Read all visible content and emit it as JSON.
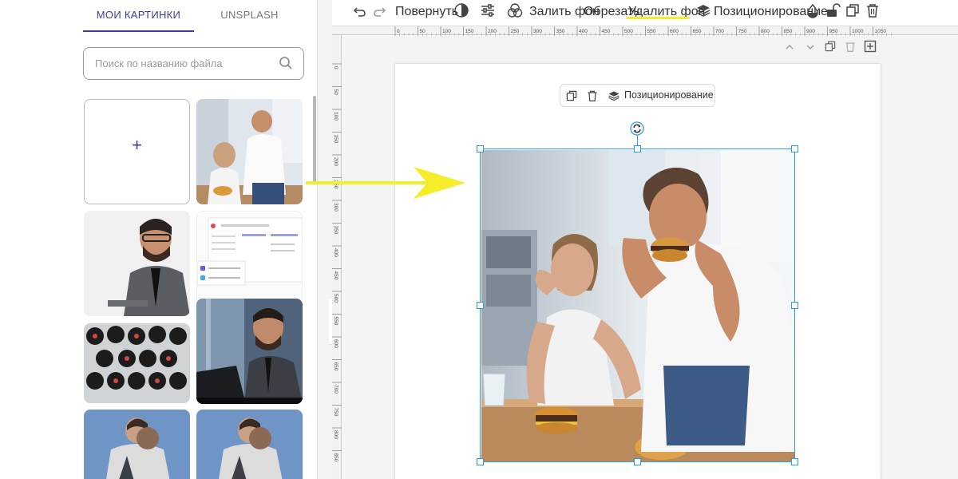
{
  "left_panel": {
    "tabs": [
      {
        "label": "МОИ КАРТИНКИ",
        "active": true
      },
      {
        "label": "UNSPLASH",
        "active": false
      }
    ],
    "search": {
      "placeholder": "Поиск по названию файла"
    },
    "add_tile": {
      "label": "+"
    }
  },
  "toolbar": {
    "rotate_label": "Повернуть",
    "fill_bg_label": "Залить фон",
    "crop_label": "Обрезать",
    "remove_bg_label": "Удалить фон",
    "positioning_label": "Позиционирование",
    "highlight_color": "#f5ec2a"
  },
  "ruler": {
    "h_ticks": [
      "0",
      "50",
      "100",
      "150",
      "200",
      "250",
      "300",
      "350",
      "400",
      "450",
      "500",
      "550",
      "600",
      "650",
      "700",
      "750",
      "800",
      "850",
      "900",
      "950",
      "1000",
      "1050"
    ],
    "v_ticks": [
      "0",
      "50",
      "100",
      "150",
      "200",
      "250",
      "300",
      "350",
      "400",
      "450",
      "500",
      "550",
      "600",
      "650",
      "700",
      "750",
      "800",
      "850"
    ]
  },
  "context_toolbar": {
    "positioning_label": "Позиционирование"
  },
  "colors": {
    "accent": "#3c3f8f",
    "selection": "#2a9fd8",
    "arrow": "#f5ec2a"
  },
  "icons": [
    "undo-icon",
    "redo-icon",
    "contrast-icon",
    "sliders-icon",
    "blend-icon",
    "layers-icon",
    "drop-icon",
    "unlock-icon",
    "duplicate-icon",
    "trash-icon",
    "search-icon",
    "rotate-handle-icon",
    "chevron-up-icon",
    "chevron-down-icon",
    "add-page-icon"
  ]
}
